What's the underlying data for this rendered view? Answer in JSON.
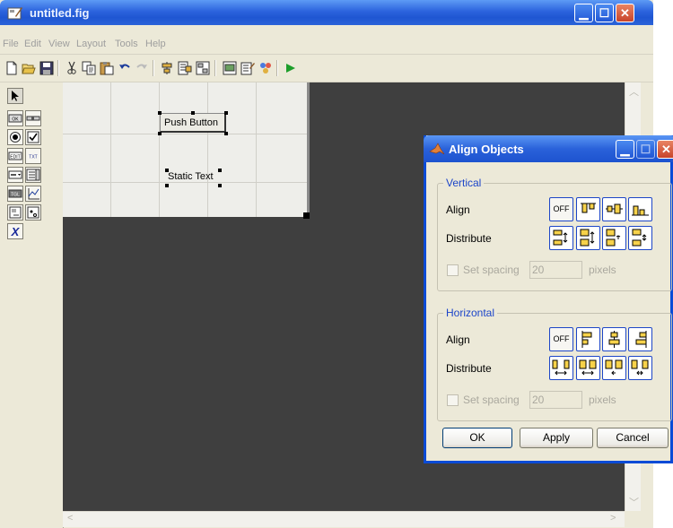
{
  "window": {
    "title": "untitled.fig"
  },
  "menu": [
    "File",
    "Edit",
    "View",
    "Layout",
    "Tools",
    "Help"
  ],
  "toolbar": {
    "icons": [
      "new-file-icon",
      "open-folder-icon",
      "save-icon",
      "cut-icon",
      "copy-icon",
      "paste-icon",
      "undo-icon",
      "redo-icon",
      "align-objects-icon",
      "menu-editor-icon",
      "tab-order-editor-icon",
      "mfile-editor-icon",
      "property-inspector-icon",
      "object-browser-icon",
      "run-icon"
    ]
  },
  "palette": {
    "items": [
      "select-arrow",
      "push-button",
      "slider",
      "radio-button",
      "checkbox",
      "edit-text",
      "static-text",
      "popup-menu",
      "listbox",
      "toggle-button",
      "axes",
      "panel",
      "button-group",
      "activex-control"
    ],
    "labels": {
      "push": "OK",
      "edit": "EDIT",
      "text": "TXT",
      "toggle": "TGL"
    }
  },
  "components": {
    "push_button": "Push Button",
    "static_text": "Static Text"
  },
  "dialog": {
    "title": "Align Objects",
    "vertical": {
      "label": "Vertical",
      "align_label": "Align",
      "distribute_label": "Distribute",
      "off_label": "OFF",
      "set_spacing_label": "Set spacing",
      "spacing_value": "20",
      "pixels_label": "pixels"
    },
    "horizontal": {
      "label": "Horizontal",
      "align_label": "Align",
      "distribute_label": "Distribute",
      "off_label": "OFF",
      "set_spacing_label": "Set spacing",
      "spacing_value": "20",
      "pixels_label": "pixels"
    },
    "buttons": {
      "ok": "OK",
      "apply": "Apply",
      "cancel": "Cancel"
    }
  },
  "colors": {
    "titlebar": "#2c63dd",
    "layout_bg": "#3f3f3f",
    "group_label": "#1c45c9",
    "play": "#1d9e2a"
  }
}
